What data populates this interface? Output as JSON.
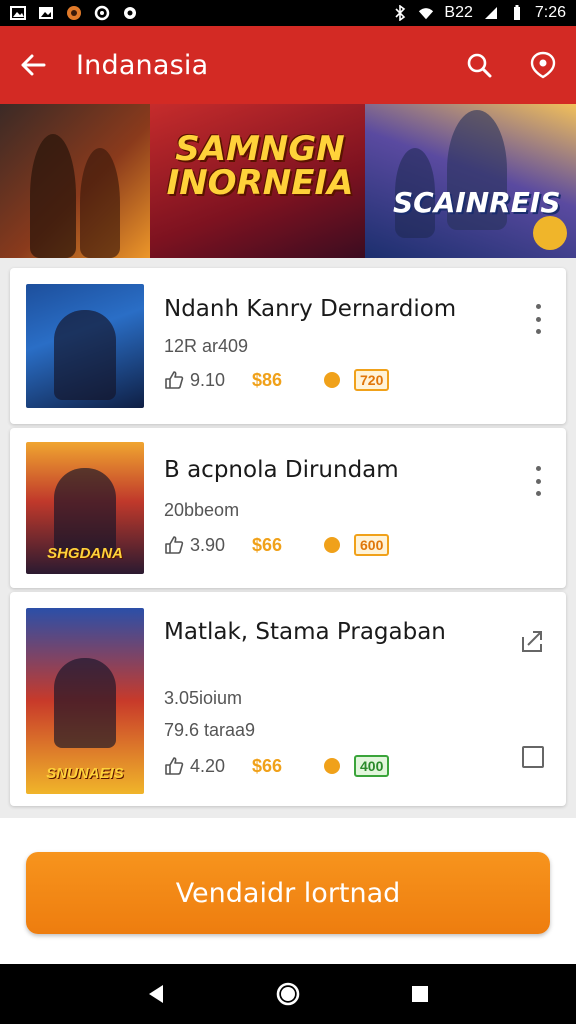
{
  "status_bar": {
    "left_icons": [
      "image-icon",
      "photo-icon",
      "app-icon",
      "circle-icon",
      "settings-icon"
    ],
    "network": "B22",
    "time": "7:26"
  },
  "app_bar": {
    "title": "Indanasia",
    "back_icon": "back-arrow-icon",
    "search_icon": "search-icon",
    "badge_icon": "shield-icon"
  },
  "banner": {
    "title": "SAMNGN INORNEIA",
    "subtitle": "SCAINREIS"
  },
  "colors": {
    "app_bar": "#d32a24",
    "accent": "#f7941d",
    "price": "#f0a11a"
  },
  "games": [
    {
      "title": "Ndanh Kanry Dernardiom",
      "meta": "12R ar409",
      "likes": "9.10",
      "price": "$86",
      "badge": "720",
      "badge_color": "orange",
      "thumb_label": ""
    },
    {
      "title": "B acpnola Dirundam",
      "meta": "20bbeom",
      "likes": "3.90",
      "price": "$66",
      "badge": "600",
      "badge_color": "orange",
      "thumb_label": "SHGDANA"
    },
    {
      "title": "Matlak, Stama Pragaban",
      "meta": "3.05ioium",
      "meta2": "79.6 taraa9",
      "likes": "4.20",
      "price": "$66",
      "badge": "400",
      "badge_color": "green",
      "thumb_label": "SNUNAEIS"
    }
  ],
  "cta": {
    "label": "Vendaidr lortnad"
  },
  "nav": {
    "back": "back-triangle-icon",
    "home": "home-circle-icon",
    "recents": "recents-square-icon"
  }
}
